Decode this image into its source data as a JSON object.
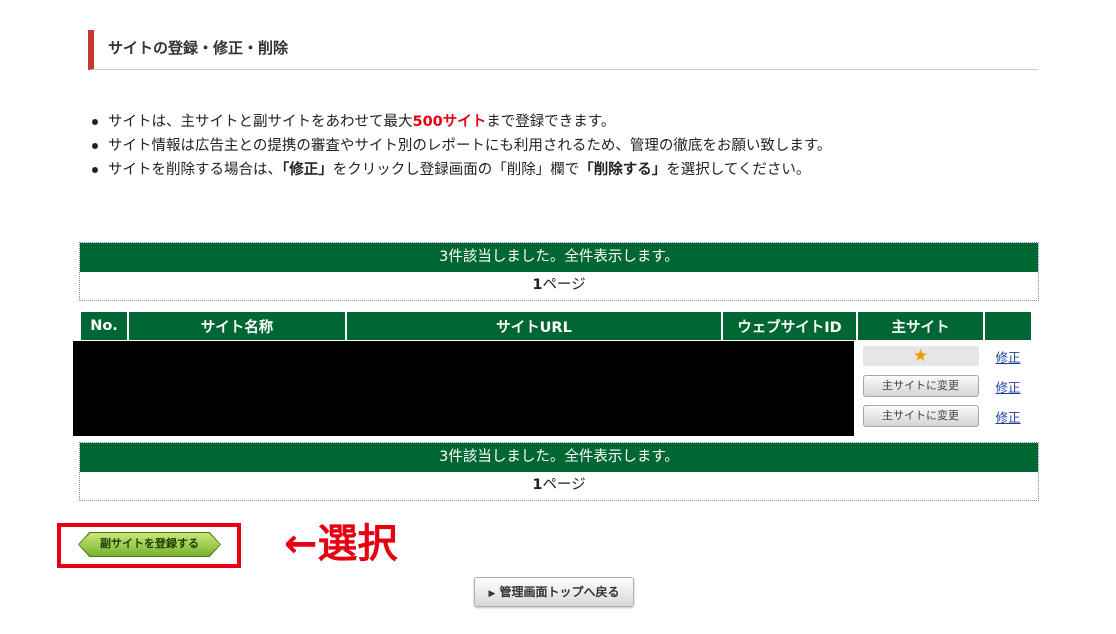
{
  "section": {
    "title": "サイトの登録・修正・削除"
  },
  "notes": [
    {
      "a": "サイトは、主サイトと副サイトをあわせて最大",
      "highlight": "500サイト",
      "b": "まで登録できます。"
    },
    {
      "text": "サイト情報は広告主との提携の審査やサイト別のレポートにも利用されるため、管理の徹底をお願い致します。"
    },
    {
      "a": "サイトを削除する場合は、",
      "bold1": "「修正」",
      "b": "をクリックし登録画面の「削除」欄で",
      "bold2": "「削除する」",
      "c": "を選択してください。"
    }
  ],
  "results": {
    "summary": "3件該当しました。全件表示します。",
    "page_number": "1",
    "page_suffix": "ページ"
  },
  "table": {
    "headers": [
      "No.",
      "サイト名称",
      "サイトURL",
      "ウェブサイトID",
      "主サイト",
      ""
    ],
    "rows": [
      {
        "main": "star",
        "edit": "修正"
      },
      {
        "main_button": "主サイトに変更",
        "edit": "修正"
      },
      {
        "main_button": "主サイトに変更",
        "edit": "修正"
      }
    ]
  },
  "actions": {
    "register_sub_site": "副サイトを登録する",
    "annotation": "←選択",
    "back_to_top": "管理画面トップへ戻る"
  },
  "colors": {
    "header_green": "#006633",
    "accent_red": "#e60012",
    "title_bar_red": "#c0392b",
    "link_blue": "#1a3f9c"
  },
  "icons": {
    "main_site": "star-icon",
    "back": "triangle-right-icon"
  }
}
